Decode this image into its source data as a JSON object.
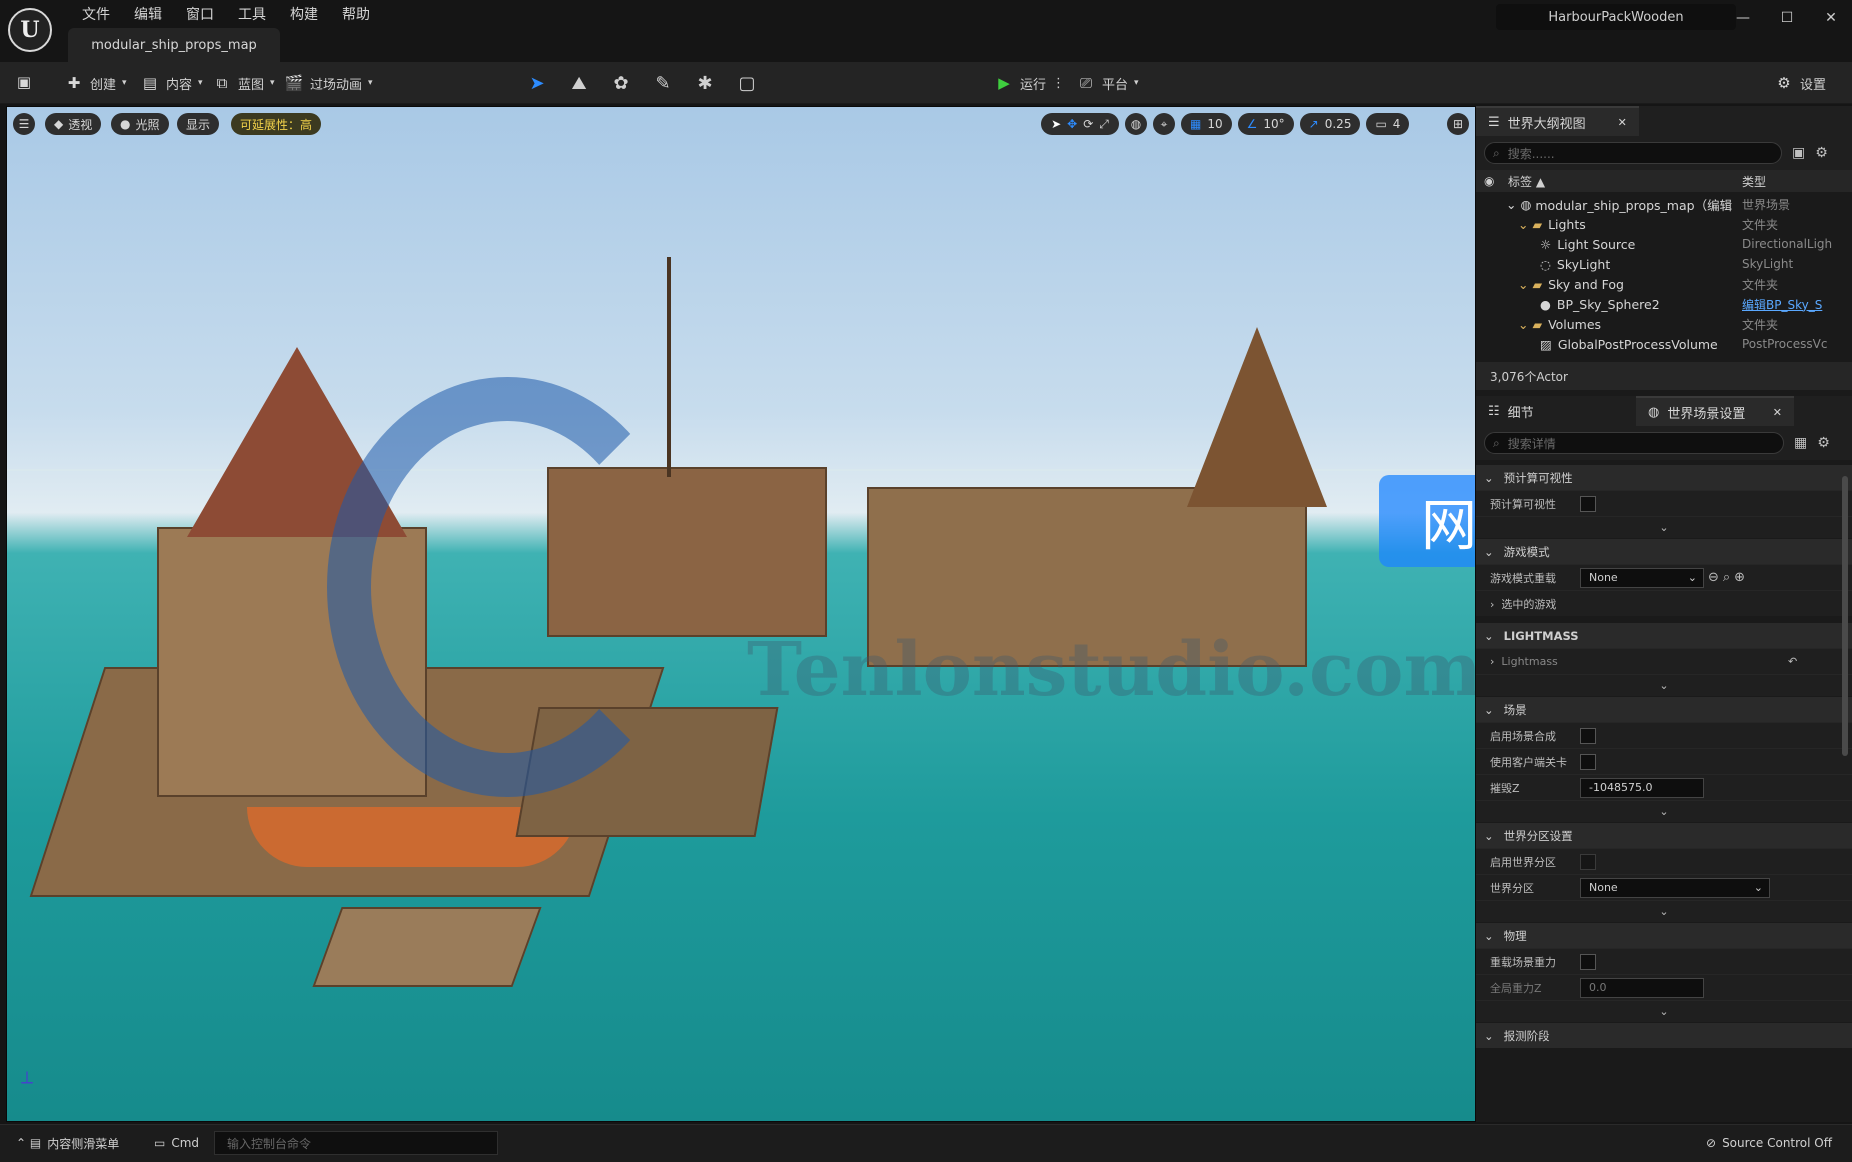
{
  "app": {
    "menu": [
      "文件",
      "编辑",
      "窗口",
      "工具",
      "构建",
      "帮助"
    ],
    "map_tab": "modular_ship_props_map",
    "project_name": "HarbourPackWooden",
    "window_buttons": {
      "minimize": "—",
      "maximize": "☐",
      "close": "✕"
    }
  },
  "toolbar": {
    "create": "创建",
    "content": "内容",
    "blueprint": "蓝图",
    "cinematics": "过场动画",
    "play": "运行",
    "platform": "平台",
    "settings": "设置",
    "mode_icons": [
      "select-mode-icon",
      "landscape-mode-icon",
      "foliage-mode-icon",
      "mesh-paint-mode-icon",
      "fracture-mode-icon",
      "modeling-mode-icon"
    ]
  },
  "viewport": {
    "left_buttons": {
      "perspective": "透视",
      "lighting": "光照",
      "show": "显示",
      "scalability": "可延展性：高"
    },
    "right_controls": {
      "grid_snap": "10",
      "rotation_snap": "10°",
      "scale_snap": "0.25",
      "camera_speed": "4"
    },
    "watermark_cn": "网站",
    "watermark_url": "Tenlonstudio.com",
    "colors": {
      "sky_top": "#a9c9e6",
      "sea": "#1e9b9c",
      "accent_blue": "#1e86ff"
    }
  },
  "outliner": {
    "title": "世界大纲视图",
    "search_placeholder": "搜索......",
    "col_label": "标签",
    "col_type": "类型",
    "rows": [
      {
        "label": "modular_ship_props_map（编辑",
        "type": "世界场景"
      },
      {
        "label": "Lights",
        "type": "文件夹"
      },
      {
        "label": "Light Source",
        "type": "DirectionalLigh"
      },
      {
        "label": "SkyLight",
        "type": "SkyLight"
      },
      {
        "label": "Sky and Fog",
        "type": "文件夹"
      },
      {
        "label": "BP_Sky_Sphere2",
        "type": "编辑BP_Sky_S"
      },
      {
        "label": "Volumes",
        "type": "文件夹"
      },
      {
        "label": "GlobalPostProcessVolume",
        "type": "PostProcessVc"
      }
    ],
    "actor_count": "3,076个Actor"
  },
  "details": {
    "tab_details": "细节",
    "tab_world_settings": "世界场景设置",
    "search_placeholder": "搜索详情",
    "sections": {
      "precomputed_visibility": "预计算可视性",
      "precomputed_visibility_row": "预计算可视性",
      "game_mode": "游戏模式",
      "game_mode_override": "游戏模式重载",
      "game_mode_value": "None",
      "selected_game": "选中的游戏",
      "lightmass": "LIGHTMASS",
      "lightmass_row": "Lightmass",
      "world": "场景",
      "enable_world_composition": "启用场景合成",
      "use_client_side": "使用客户端关卡",
      "kill_z": "摧毁Z",
      "kill_z_value": "-1048575.0",
      "world_partition_settings": "世界分区设置",
      "enable_world_partition": "启用世界分区",
      "world_partition": "世界分区",
      "world_partition_value": "None",
      "physics": "物理",
      "override_gravity": "重载场景重力",
      "global_gravity_z": "全局重力Z",
      "global_gravity_value": "0.0",
      "broadphase": "报测阶段"
    }
  },
  "statusbar": {
    "content_drawer": "内容侧滑菜单",
    "cmd": "Cmd",
    "console_placeholder": "输入控制台命令",
    "source_control": "Source Control Off"
  }
}
